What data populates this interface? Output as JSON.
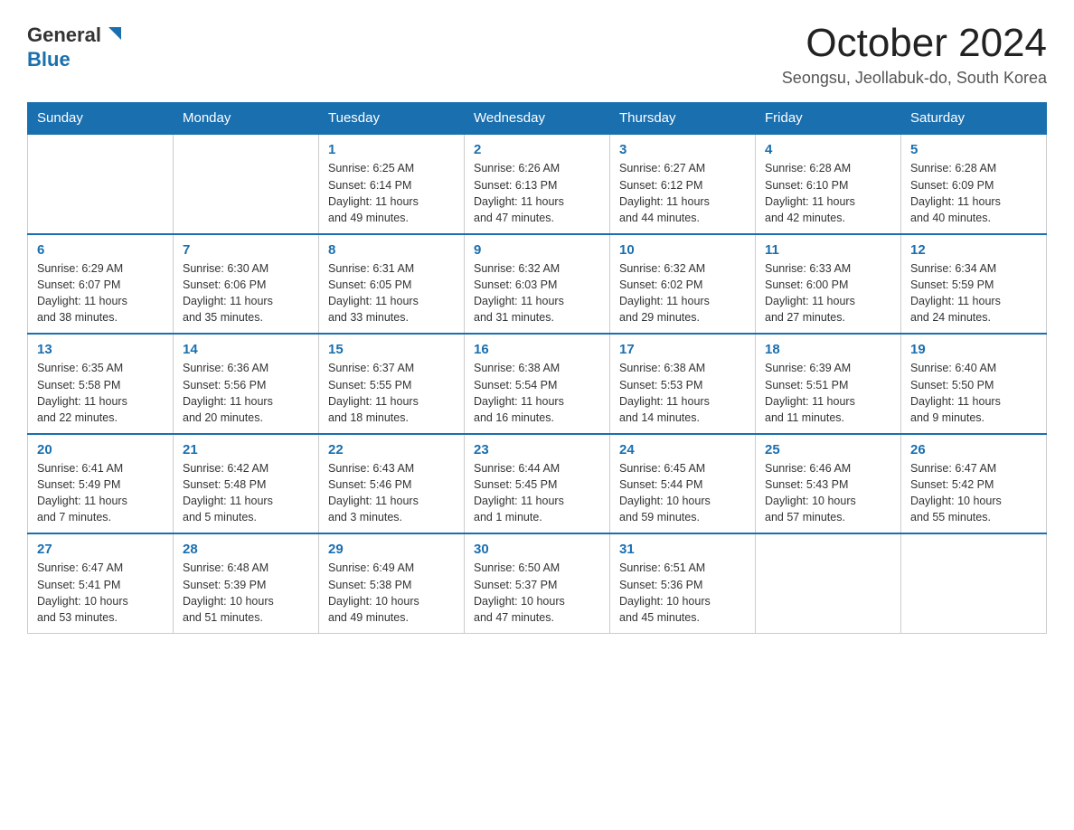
{
  "header": {
    "logo_general": "General",
    "logo_blue": "Blue",
    "month_year": "October 2024",
    "location": "Seongsu, Jeollabuk-do, South Korea"
  },
  "days_of_week": [
    "Sunday",
    "Monday",
    "Tuesday",
    "Wednesday",
    "Thursday",
    "Friday",
    "Saturday"
  ],
  "weeks": [
    [
      {
        "day": "",
        "info": ""
      },
      {
        "day": "",
        "info": ""
      },
      {
        "day": "1",
        "info": "Sunrise: 6:25 AM\nSunset: 6:14 PM\nDaylight: 11 hours\nand 49 minutes."
      },
      {
        "day": "2",
        "info": "Sunrise: 6:26 AM\nSunset: 6:13 PM\nDaylight: 11 hours\nand 47 minutes."
      },
      {
        "day": "3",
        "info": "Sunrise: 6:27 AM\nSunset: 6:12 PM\nDaylight: 11 hours\nand 44 minutes."
      },
      {
        "day": "4",
        "info": "Sunrise: 6:28 AM\nSunset: 6:10 PM\nDaylight: 11 hours\nand 42 minutes."
      },
      {
        "day": "5",
        "info": "Sunrise: 6:28 AM\nSunset: 6:09 PM\nDaylight: 11 hours\nand 40 minutes."
      }
    ],
    [
      {
        "day": "6",
        "info": "Sunrise: 6:29 AM\nSunset: 6:07 PM\nDaylight: 11 hours\nand 38 minutes."
      },
      {
        "day": "7",
        "info": "Sunrise: 6:30 AM\nSunset: 6:06 PM\nDaylight: 11 hours\nand 35 minutes."
      },
      {
        "day": "8",
        "info": "Sunrise: 6:31 AM\nSunset: 6:05 PM\nDaylight: 11 hours\nand 33 minutes."
      },
      {
        "day": "9",
        "info": "Sunrise: 6:32 AM\nSunset: 6:03 PM\nDaylight: 11 hours\nand 31 minutes."
      },
      {
        "day": "10",
        "info": "Sunrise: 6:32 AM\nSunset: 6:02 PM\nDaylight: 11 hours\nand 29 minutes."
      },
      {
        "day": "11",
        "info": "Sunrise: 6:33 AM\nSunset: 6:00 PM\nDaylight: 11 hours\nand 27 minutes."
      },
      {
        "day": "12",
        "info": "Sunrise: 6:34 AM\nSunset: 5:59 PM\nDaylight: 11 hours\nand 24 minutes."
      }
    ],
    [
      {
        "day": "13",
        "info": "Sunrise: 6:35 AM\nSunset: 5:58 PM\nDaylight: 11 hours\nand 22 minutes."
      },
      {
        "day": "14",
        "info": "Sunrise: 6:36 AM\nSunset: 5:56 PM\nDaylight: 11 hours\nand 20 minutes."
      },
      {
        "day": "15",
        "info": "Sunrise: 6:37 AM\nSunset: 5:55 PM\nDaylight: 11 hours\nand 18 minutes."
      },
      {
        "day": "16",
        "info": "Sunrise: 6:38 AM\nSunset: 5:54 PM\nDaylight: 11 hours\nand 16 minutes."
      },
      {
        "day": "17",
        "info": "Sunrise: 6:38 AM\nSunset: 5:53 PM\nDaylight: 11 hours\nand 14 minutes."
      },
      {
        "day": "18",
        "info": "Sunrise: 6:39 AM\nSunset: 5:51 PM\nDaylight: 11 hours\nand 11 minutes."
      },
      {
        "day": "19",
        "info": "Sunrise: 6:40 AM\nSunset: 5:50 PM\nDaylight: 11 hours\nand 9 minutes."
      }
    ],
    [
      {
        "day": "20",
        "info": "Sunrise: 6:41 AM\nSunset: 5:49 PM\nDaylight: 11 hours\nand 7 minutes."
      },
      {
        "day": "21",
        "info": "Sunrise: 6:42 AM\nSunset: 5:48 PM\nDaylight: 11 hours\nand 5 minutes."
      },
      {
        "day": "22",
        "info": "Sunrise: 6:43 AM\nSunset: 5:46 PM\nDaylight: 11 hours\nand 3 minutes."
      },
      {
        "day": "23",
        "info": "Sunrise: 6:44 AM\nSunset: 5:45 PM\nDaylight: 11 hours\nand 1 minute."
      },
      {
        "day": "24",
        "info": "Sunrise: 6:45 AM\nSunset: 5:44 PM\nDaylight: 10 hours\nand 59 minutes."
      },
      {
        "day": "25",
        "info": "Sunrise: 6:46 AM\nSunset: 5:43 PM\nDaylight: 10 hours\nand 57 minutes."
      },
      {
        "day": "26",
        "info": "Sunrise: 6:47 AM\nSunset: 5:42 PM\nDaylight: 10 hours\nand 55 minutes."
      }
    ],
    [
      {
        "day": "27",
        "info": "Sunrise: 6:47 AM\nSunset: 5:41 PM\nDaylight: 10 hours\nand 53 minutes."
      },
      {
        "day": "28",
        "info": "Sunrise: 6:48 AM\nSunset: 5:39 PM\nDaylight: 10 hours\nand 51 minutes."
      },
      {
        "day": "29",
        "info": "Sunrise: 6:49 AM\nSunset: 5:38 PM\nDaylight: 10 hours\nand 49 minutes."
      },
      {
        "day": "30",
        "info": "Sunrise: 6:50 AM\nSunset: 5:37 PM\nDaylight: 10 hours\nand 47 minutes."
      },
      {
        "day": "31",
        "info": "Sunrise: 6:51 AM\nSunset: 5:36 PM\nDaylight: 10 hours\nand 45 minutes."
      },
      {
        "day": "",
        "info": ""
      },
      {
        "day": "",
        "info": ""
      }
    ]
  ]
}
